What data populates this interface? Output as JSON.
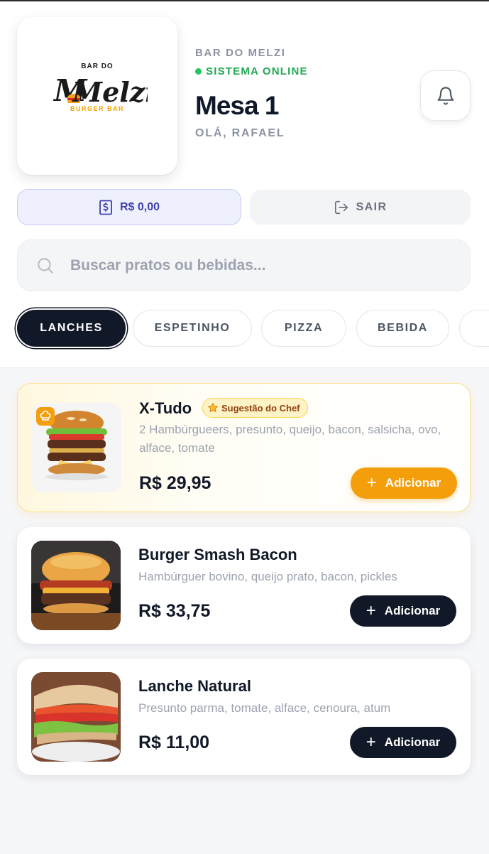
{
  "brand": {
    "logo_top": "BAR DO",
    "logo_name": "Melzi",
    "logo_sub": "BURGER BAR",
    "name": "BAR DO MELZI",
    "status": "SISTEMA ONLINE"
  },
  "table": {
    "title": "Mesa 1",
    "greeting": "OLÁ, RAFAEL"
  },
  "actions": {
    "balance": "R$ 0,00",
    "logout": "SAIR"
  },
  "search": {
    "placeholder": "Buscar pratos ou bebidas..."
  },
  "categories": [
    {
      "label": "LANCHES",
      "active": true
    },
    {
      "label": "ESPETINHO",
      "active": false
    },
    {
      "label": "PIZZA",
      "active": false
    },
    {
      "label": "BEBIDA",
      "active": false
    }
  ],
  "menu": {
    "items": [
      {
        "name": "X-Tudo",
        "tag": "Sugestão do Chef",
        "description": "2 Hambúrgueers, presunto, queijo, bacon, salsicha, ovo, alface, tomate",
        "price": "R$ 29,95",
        "add_label": "Adicionar"
      },
      {
        "name": "Burger Smash Bacon",
        "description": "Hambúrguer bovino, queijo prato, bacon, pickles",
        "price": "R$ 33,75",
        "add_label": "Adicionar"
      },
      {
        "name": "Lanche Natural",
        "description": "Presunto parma, tomate, alface, cenoura, atum",
        "price": "R$ 11,00",
        "add_label": "Adicionar"
      }
    ]
  },
  "colors": {
    "online": "#22a853",
    "dark": "#111827",
    "accent_amber": "#f59e0b",
    "balance_blue": "#3f3fb0"
  }
}
